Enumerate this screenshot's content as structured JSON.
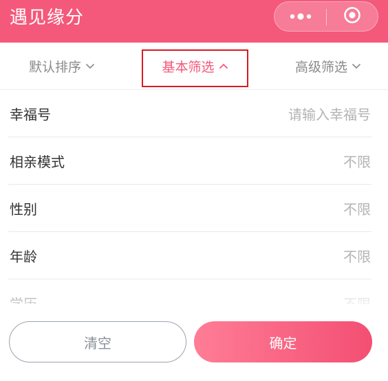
{
  "header": {
    "title": "遇见缘分",
    "more_icon": "more-dots-icon",
    "close_icon": "close-circle-icon",
    "background_color": "#f4587a"
  },
  "tabs": [
    {
      "label": "默认排序",
      "state": "collapsed",
      "icon": "chevron-down-icon"
    },
    {
      "label": "基本筛选",
      "state": "expanded",
      "icon": "chevron-up-icon",
      "active": true
    },
    {
      "label": "高级筛选",
      "state": "collapsed",
      "icon": "chevron-down-icon"
    }
  ],
  "filters": [
    {
      "label": "幸福号",
      "value": "请输入幸福号"
    },
    {
      "label": "相亲模式",
      "value": "不限"
    },
    {
      "label": "性别",
      "value": "不限"
    },
    {
      "label": "年龄",
      "value": "不限"
    },
    {
      "label": "学历",
      "value": "不限"
    }
  ],
  "buttons": {
    "clear_label": "清空",
    "confirm_label": "确定"
  },
  "colors": {
    "accent": "#f4587a",
    "highlight_box": "#d9191f",
    "muted_text": "#b3b3b3"
  }
}
